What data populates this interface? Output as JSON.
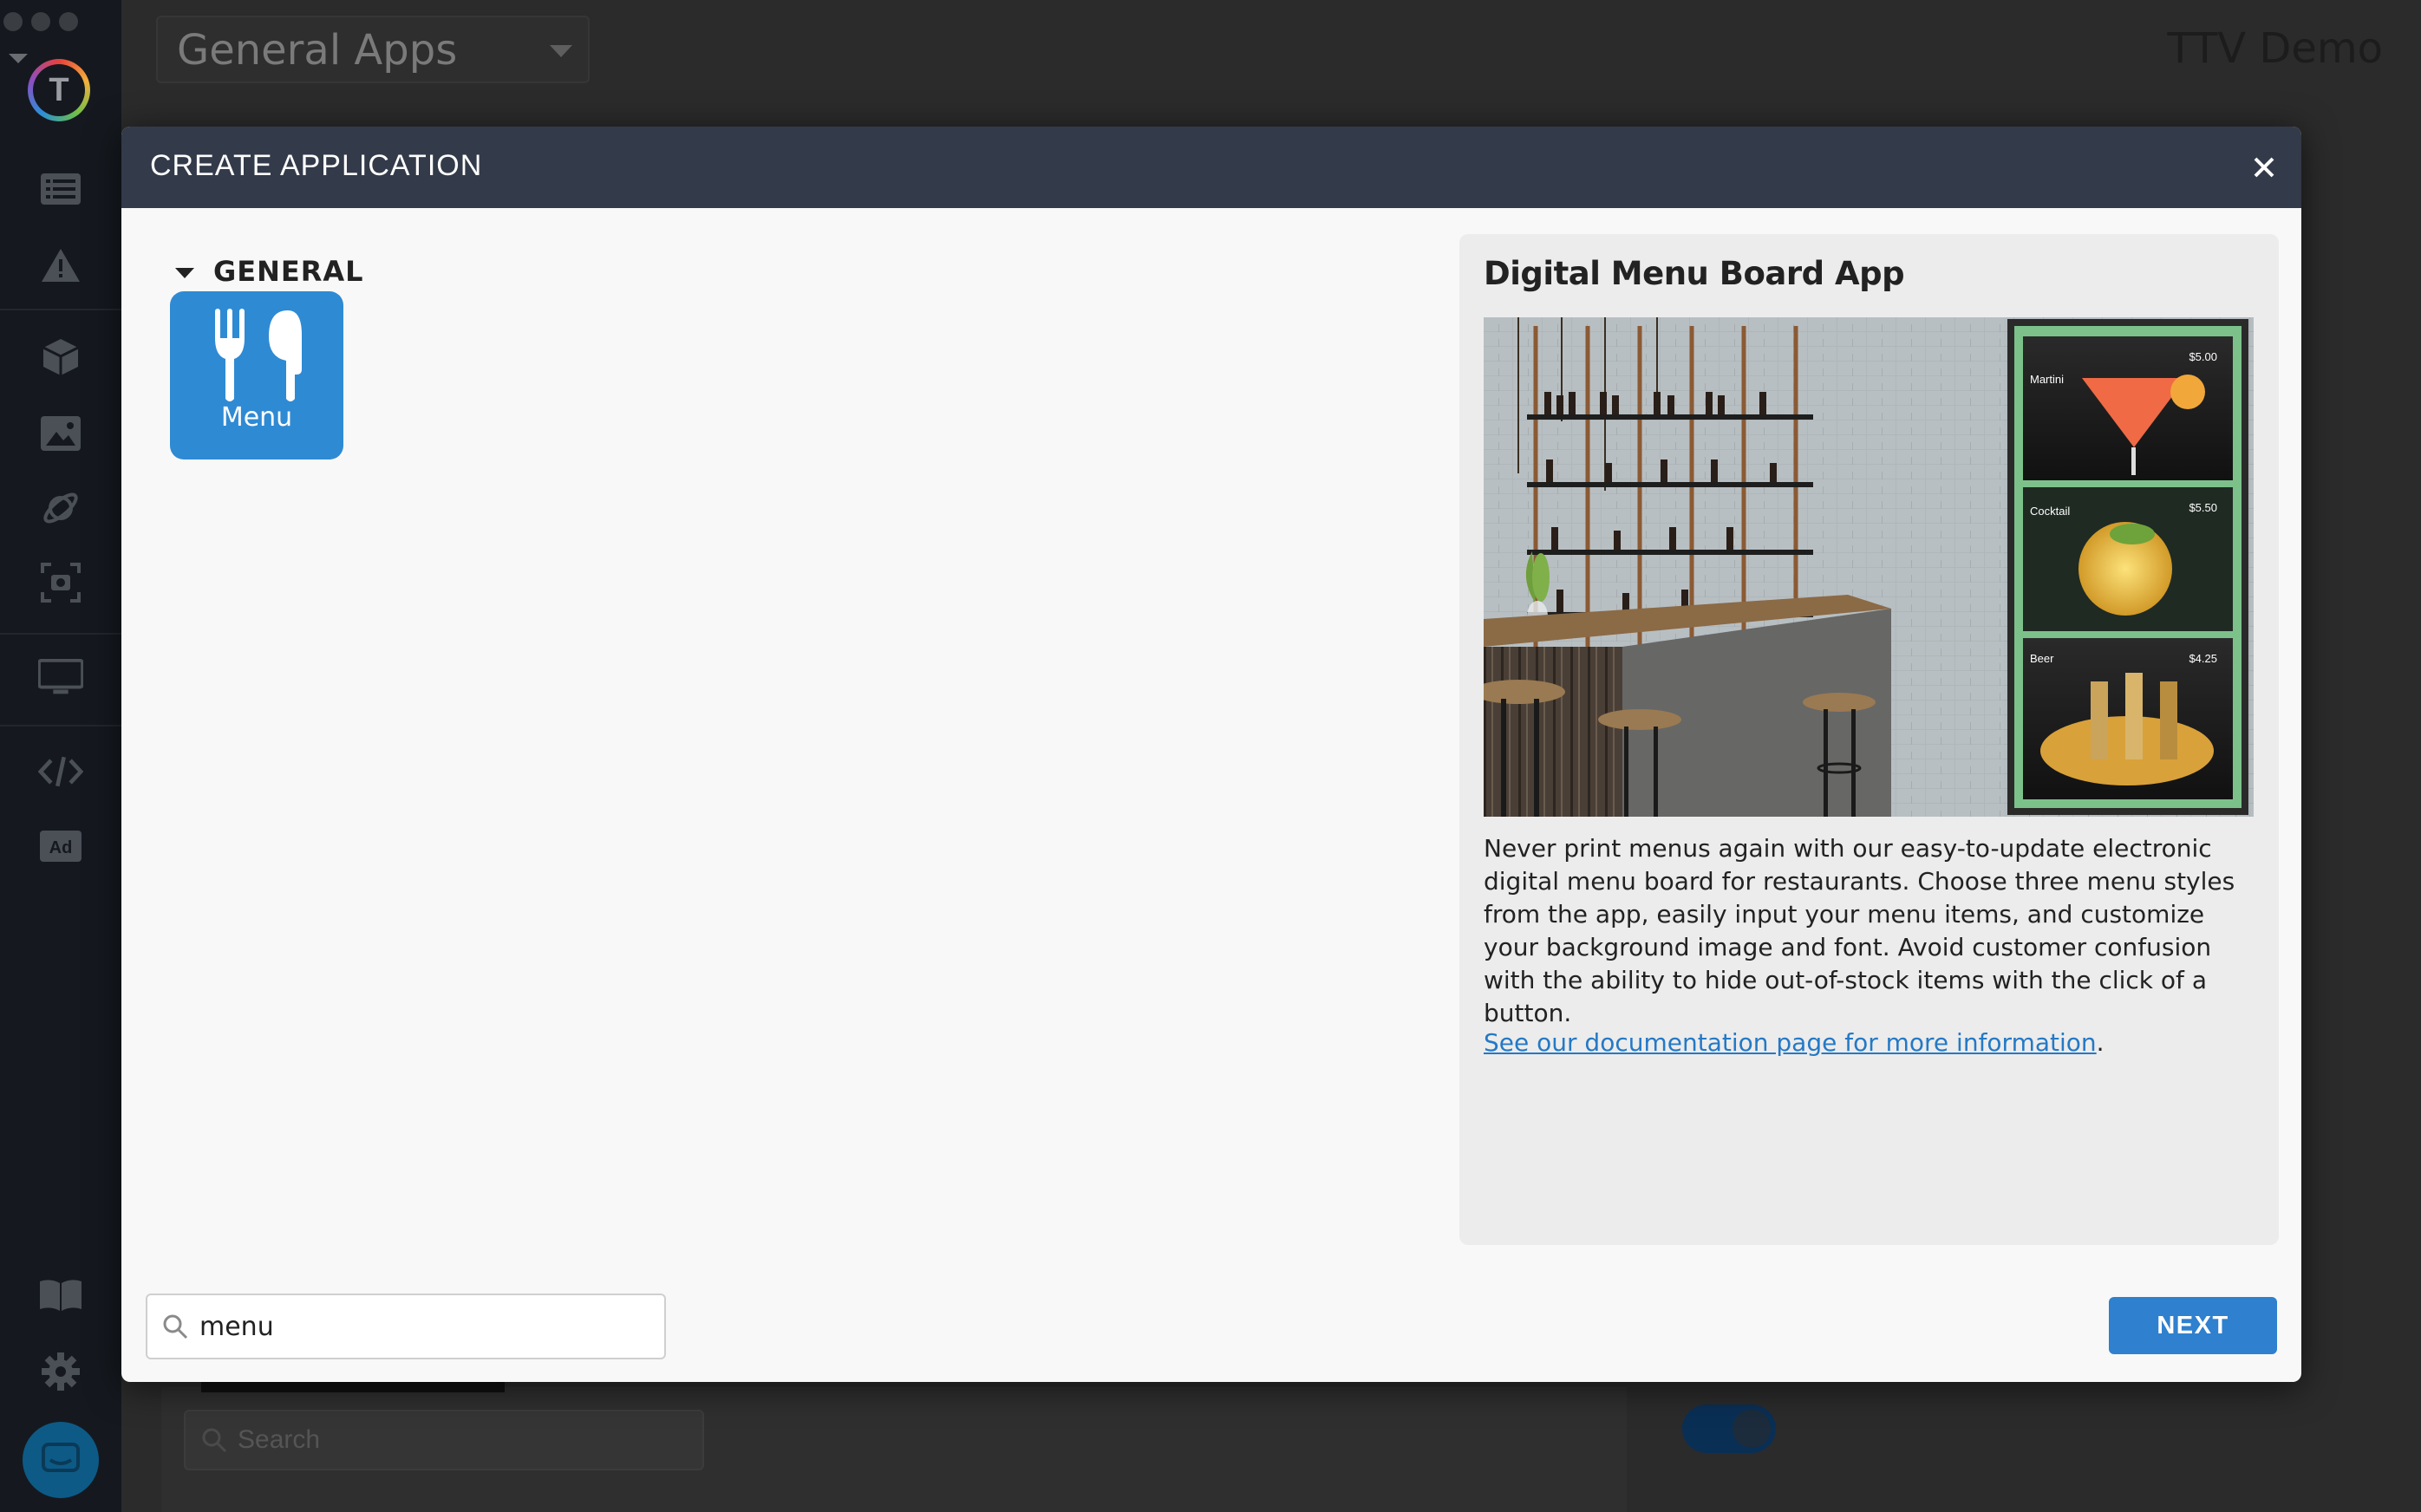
{
  "background": {
    "app_selector_value": "General Apps",
    "brand": "TTV Demo",
    "search_placeholder": "Search"
  },
  "sidebar": {
    "icons": [
      "list-icon",
      "warning-icon",
      "cube-icon",
      "image-icon",
      "planet-icon",
      "screenshot-icon",
      "monitor-icon",
      "code-icon",
      "ad-icon",
      "book-icon",
      "gear-icon",
      "chat-icon"
    ]
  },
  "modal": {
    "title": "CREATE APPLICATION",
    "group_label": "GENERAL",
    "app_tile_label": "Menu",
    "detail": {
      "title": "Digital Menu Board App",
      "description": "Never print menus again with our easy-to-update electronic digital menu board for restaurants. Choose three menu styles from the app, easily input your menu items, and customize your background image and font. Avoid customer confusion with the ability to hide out-of-stock items with the click of a button.",
      "link_text": "See our documentation page for more information",
      "link_suffix": ".",
      "image_prices": [
        "$5.00",
        "$5.50",
        "$4.25"
      ],
      "image_labels": [
        "Martini",
        "Cocktail",
        "Beer"
      ]
    },
    "search_value": "menu",
    "next_label": "NEXT"
  },
  "colors": {
    "header_bg": "#333a49",
    "accent_blue": "#2f80ce",
    "tile_blue": "#2f8ad4",
    "link_blue": "#2479c6"
  }
}
